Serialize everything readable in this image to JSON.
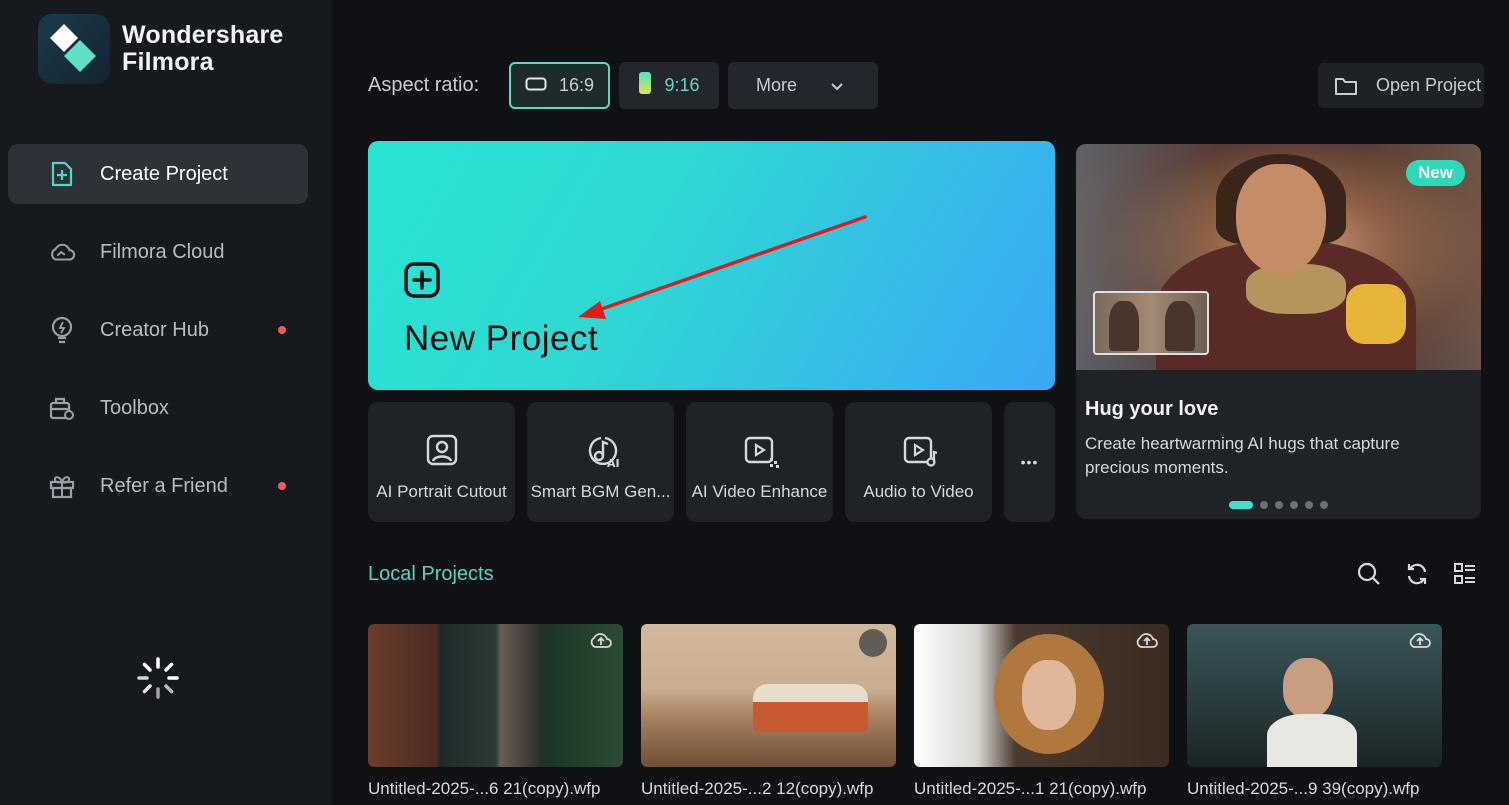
{
  "app": {
    "brand_line1": "Wondershare",
    "brand_line2": "Filmora"
  },
  "sidebar": {
    "items": [
      {
        "label": "Create Project",
        "icon": "add-file-icon",
        "active": true,
        "dot": false
      },
      {
        "label": "Filmora Cloud",
        "icon": "cloud-icon",
        "active": false,
        "dot": false
      },
      {
        "label": "Creator Hub",
        "icon": "bulb-icon",
        "active": false,
        "dot": true
      },
      {
        "label": "Toolbox",
        "icon": "toolbox-icon",
        "active": false,
        "dot": false
      },
      {
        "label": "Refer a Friend",
        "icon": "gift-icon",
        "active": false,
        "dot": true
      }
    ]
  },
  "toolbar": {
    "aspect_label": "Aspect ratio:",
    "ratio_16_9": "16:9",
    "ratio_9_16": "9:16",
    "more_label": "More",
    "open_project": "Open Project"
  },
  "new_project": {
    "title": "New Project"
  },
  "tools": [
    {
      "label": "AI Portrait Cutout",
      "icon": "portrait-icon"
    },
    {
      "label": "Smart BGM Gen...",
      "icon": "music-ai-icon"
    },
    {
      "label": "AI Video Enhance",
      "icon": "video-enhance-icon"
    },
    {
      "label": "Audio to Video",
      "icon": "audio-video-icon"
    }
  ],
  "tools_more": "•••",
  "promo": {
    "badge": "New",
    "title": "Hug your love",
    "description": "Create heartwarming AI hugs that capture precious moments.",
    "slides": 6,
    "active_slide": 1
  },
  "local_projects": {
    "title": "Local Projects",
    "items": [
      {
        "name": "Untitled-2025-...6 21(copy).wfp"
      },
      {
        "name": "Untitled-2025-...2 12(copy).wfp"
      },
      {
        "name": "Untitled-2025-...1 21(copy).wfp"
      },
      {
        "name": "Untitled-2025-...9 39(copy).wfp"
      }
    ]
  },
  "colors": {
    "accent": "#4fd9c3",
    "background": "#0f1115",
    "sidebar": "#16191e",
    "notification_dot": "#f25a5a"
  }
}
